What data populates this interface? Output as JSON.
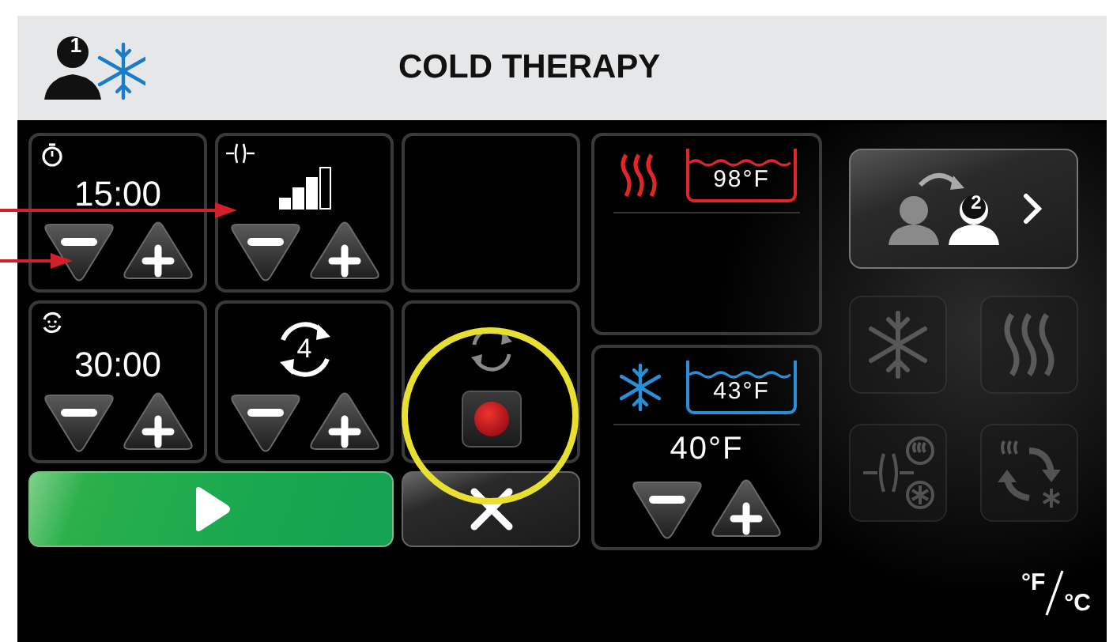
{
  "header": {
    "user_badge": "1",
    "title": "COLD THERAPY"
  },
  "tiles": [
    {
      "kind": "timer",
      "value": "15:00"
    },
    {
      "kind": "compression",
      "level": 0.75
    },
    {
      "kind": "empty"
    },
    {
      "kind": "cycle-timer",
      "value": "30:00"
    },
    {
      "kind": "cycles",
      "value": "4"
    },
    {
      "kind": "record"
    }
  ],
  "actions": [
    {
      "kind": "start"
    },
    {
      "kind": "cancel"
    }
  ],
  "reservoirs": [
    {
      "kind": "hot",
      "temperature": "98°F"
    },
    {
      "kind": "cold",
      "temperature": "43°F",
      "setpoint": "40°F"
    }
  ],
  "profile_switch": {
    "user_badge": "2"
  },
  "modes": [
    {
      "kind": "cold",
      "disabled": true
    },
    {
      "kind": "heat",
      "disabled": true
    },
    {
      "kind": "compression-contrast",
      "disabled": true
    },
    {
      "kind": "contrast",
      "disabled": true
    }
  ],
  "units": {
    "primary": "°F",
    "secondary": "°C"
  },
  "annotations": [
    {
      "kind": "arrow"
    },
    {
      "kind": "arrow"
    },
    {
      "kind": "circle"
    }
  ]
}
